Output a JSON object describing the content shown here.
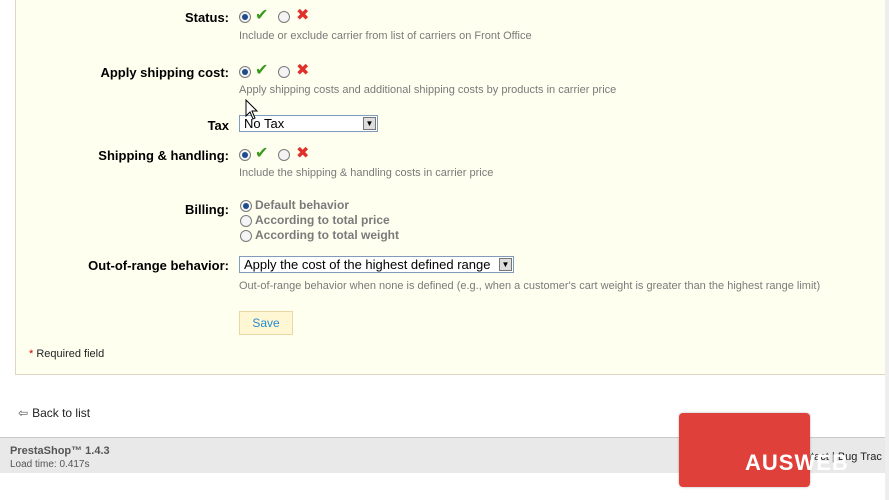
{
  "form": {
    "status": {
      "label": "Status:",
      "help": "Include or exclude carrier from list of carriers on Front Office",
      "selected": "yes"
    },
    "apply_shipping_cost": {
      "label": "Apply shipping cost:",
      "help": "Apply shipping costs and additional shipping costs by products in carrier price",
      "selected": "yes"
    },
    "tax": {
      "label": "Tax",
      "value": "No Tax"
    },
    "shipping_handling": {
      "label": "Shipping & handling:",
      "help": "Include the shipping & handling costs in carrier price",
      "selected": "yes"
    },
    "billing": {
      "label": "Billing:",
      "options": [
        "Default behavior",
        "According to total price",
        "According to total weight"
      ],
      "selected_index": 0
    },
    "out_of_range": {
      "label": "Out-of-range behavior:",
      "value": "Apply the cost of the highest defined range",
      "help": "Out-of-range behavior when none is defined (e.g., when a customer's cart weight is greater than the highest range limit)"
    },
    "save_label": "Save",
    "required_star": "*",
    "required_text": "Required field"
  },
  "icons": {
    "yes": "check-icon",
    "no": "cross-icon",
    "back": "back-arrow-icon",
    "yes_color": "#3a9a1c",
    "no_color": "#e0302a"
  },
  "back_link": "Back to list",
  "footer": {
    "version": "PrestaShop™ 1.4.3",
    "load_time": "Load time: 0.417s",
    "links": "ntact | Bug Trac"
  },
  "watermark": {
    "text": "AUSWEB",
    "color": "#e0403a"
  }
}
